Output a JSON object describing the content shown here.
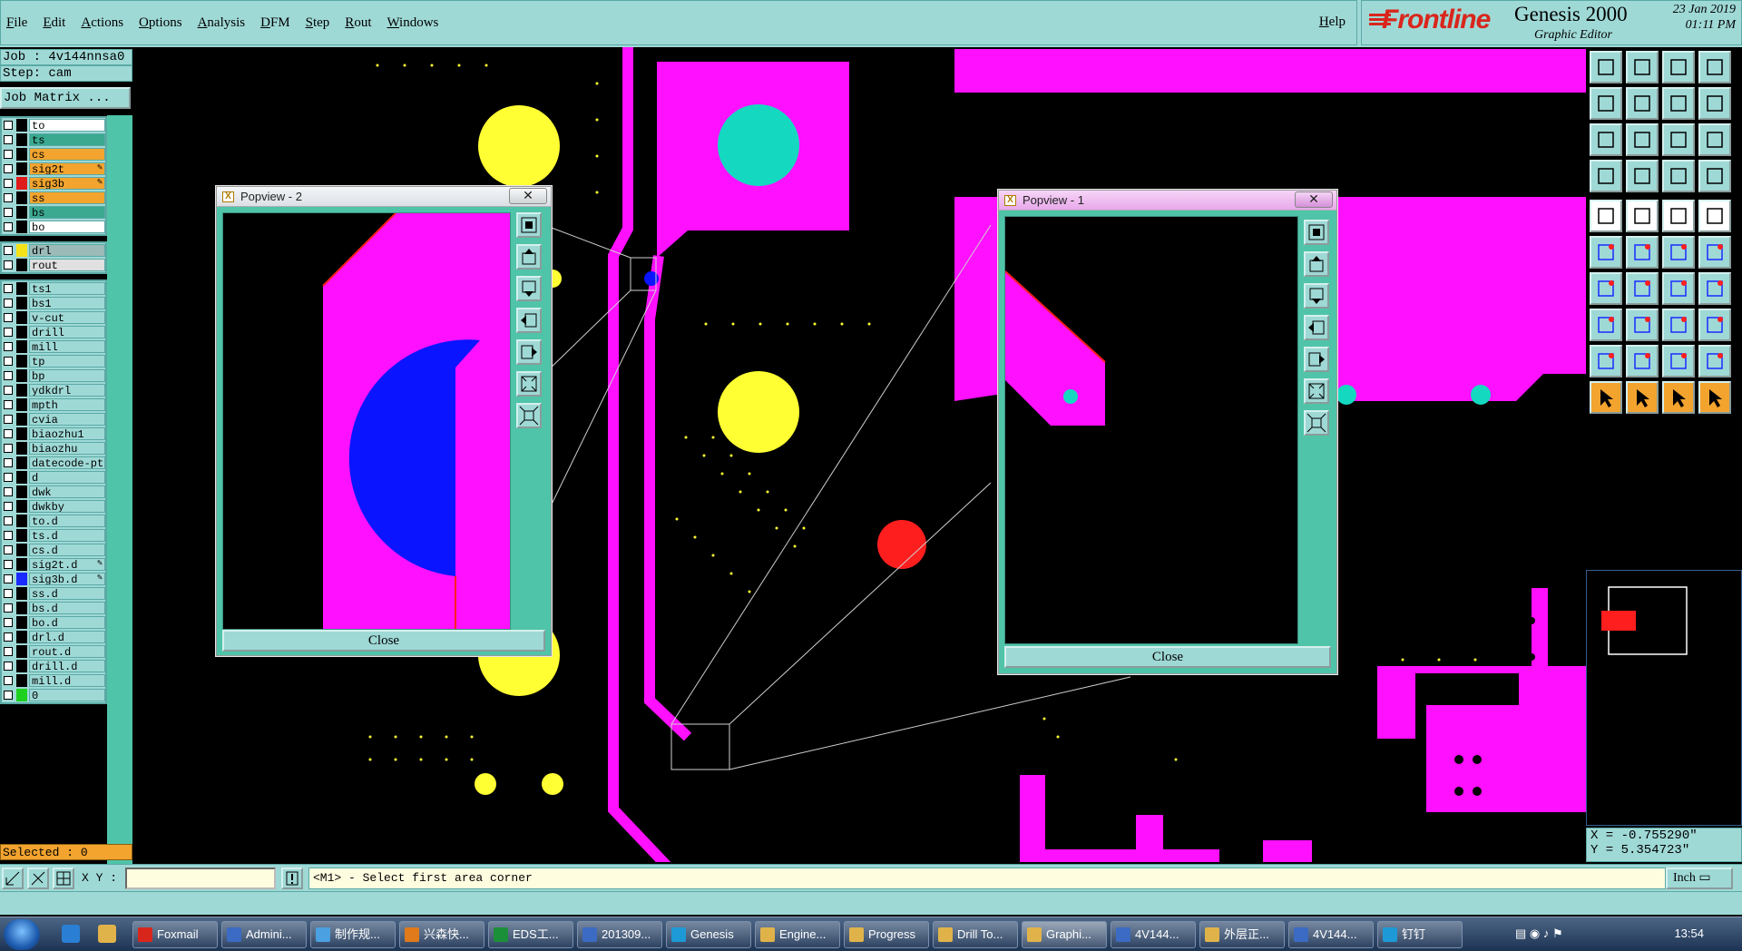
{
  "menu": {
    "items": [
      "File",
      "Edit",
      "Actions",
      "Options",
      "Analysis",
      "DFM",
      "Step",
      "Rout",
      "Windows"
    ],
    "help": "Help"
  },
  "brand": {
    "logo": "Frontline",
    "product": "Genesis 2000",
    "subtitle": "Graphic Editor",
    "date": "23 Jan 2019",
    "time": "01:11 PM"
  },
  "job": {
    "job_line": "Job : 4v144nnsa0",
    "step_line": "Step: cam",
    "matrix_button": "Job Matrix ...",
    "selected": "Selected : 0"
  },
  "layers": {
    "group1": [
      {
        "name": "to",
        "bg": "#ffffff",
        "color": "#000000",
        "pen": ""
      },
      {
        "name": "ts",
        "bg": "#3aa98f",
        "color": "#000000",
        "pen": ""
      },
      {
        "name": "cs",
        "bg": "#f2a42f",
        "color": "#000000",
        "pen": ""
      },
      {
        "name": "sig2t",
        "bg": "#f2a42f",
        "color": "#000000",
        "pen": "✎"
      },
      {
        "name": "sig3b",
        "bg": "#f2a42f",
        "color": "#e01b1b",
        "pen": "✎"
      },
      {
        "name": "ss",
        "bg": "#f2a42f",
        "color": "#000000",
        "pen": ""
      },
      {
        "name": "bs",
        "bg": "#3aa98f",
        "color": "#000000",
        "pen": ""
      },
      {
        "name": "bo",
        "bg": "#ffffff",
        "color": "#000000",
        "pen": ""
      }
    ],
    "group2": [
      {
        "name": "drl",
        "bg": "#9bbab8",
        "color": "#f5e31a",
        "pen": ""
      },
      {
        "name": "rout",
        "bg": "#e0e0e0",
        "color": "#000000",
        "pen": ""
      }
    ],
    "group3": [
      {
        "name": "ts1",
        "color": "#000000",
        "pen": ""
      },
      {
        "name": "bs1",
        "color": "#000000",
        "pen": ""
      },
      {
        "name": "v-cut",
        "color": "#000000",
        "pen": ""
      },
      {
        "name": "drill",
        "color": "#000000",
        "pen": ""
      },
      {
        "name": "mill",
        "color": "#000000",
        "pen": ""
      },
      {
        "name": "tp",
        "color": "#000000",
        "pen": ""
      },
      {
        "name": "bp",
        "color": "#000000",
        "pen": ""
      },
      {
        "name": "ydkdrl",
        "color": "#000000",
        "pen": ""
      },
      {
        "name": "mpth",
        "color": "#000000",
        "pen": ""
      },
      {
        "name": "cvia",
        "color": "#000000",
        "pen": ""
      },
      {
        "name": "biaozhu1",
        "color": "#000000",
        "pen": ""
      },
      {
        "name": "biaozhu",
        "color": "#000000",
        "pen": ""
      },
      {
        "name": "datecode-pt",
        "color": "#000000",
        "pen": ""
      },
      {
        "name": "d",
        "color": "#000000",
        "pen": ""
      },
      {
        "name": "dwk",
        "color": "#000000",
        "pen": ""
      },
      {
        "name": "dwkby",
        "color": "#000000",
        "pen": ""
      },
      {
        "name": "to.d",
        "color": "#000000",
        "pen": ""
      },
      {
        "name": "ts.d",
        "color": "#000000",
        "pen": ""
      },
      {
        "name": "cs.d",
        "color": "#000000",
        "pen": ""
      },
      {
        "name": "sig2t.d",
        "color": "#000000",
        "pen": "✎"
      },
      {
        "name": "sig3b.d",
        "color": "#1a2bff",
        "pen": "✎"
      },
      {
        "name": "ss.d",
        "color": "#000000",
        "pen": ""
      },
      {
        "name": "bs.d",
        "color": "#000000",
        "pen": ""
      },
      {
        "name": "bo.d",
        "color": "#000000",
        "pen": ""
      },
      {
        "name": "drl.d",
        "color": "#000000",
        "pen": ""
      },
      {
        "name": "rout.d",
        "color": "#000000",
        "pen": ""
      },
      {
        "name": "drill.d",
        "color": "#000000",
        "pen": ""
      },
      {
        "name": "mill.d",
        "color": "#000000",
        "pen": ""
      },
      {
        "name": "0",
        "color": "#1fd11f",
        "pen": ""
      }
    ]
  },
  "popups": {
    "popview2": {
      "title": "Popview - 2",
      "close": "Close",
      "x": "✕"
    },
    "popview1": {
      "title": "Popview - 1",
      "close": "Close",
      "x": "✕"
    }
  },
  "coords": {
    "x": "X = -0.755290\"",
    "y": "Y = 5.354723\""
  },
  "command": {
    "xy_label": "X Y :",
    "xy_value": "",
    "prompt": "<M1> - Select first area corner",
    "units": "Inch"
  },
  "taskbar": {
    "items": [
      "Foxmail",
      "Admini...",
      "制作规...",
      "兴森快...",
      "EDS工...",
      "201309...",
      "Genesis",
      "Engine...",
      "Progress",
      "Drill To...",
      "Graphi...",
      "4V144...",
      "外层正...",
      "4V144...",
      "钉钉"
    ],
    "clock": "13:54"
  },
  "colors": {
    "panel": "#9fd9d6",
    "toolbar_green": "#4fc4a9",
    "copper_magenta": "#ff10ff",
    "pad_yellow": "#ffff33",
    "pad_cyan": "#14d9c0",
    "blue_feature": "#0a14ff",
    "red_feature": "#ff1e1e"
  }
}
